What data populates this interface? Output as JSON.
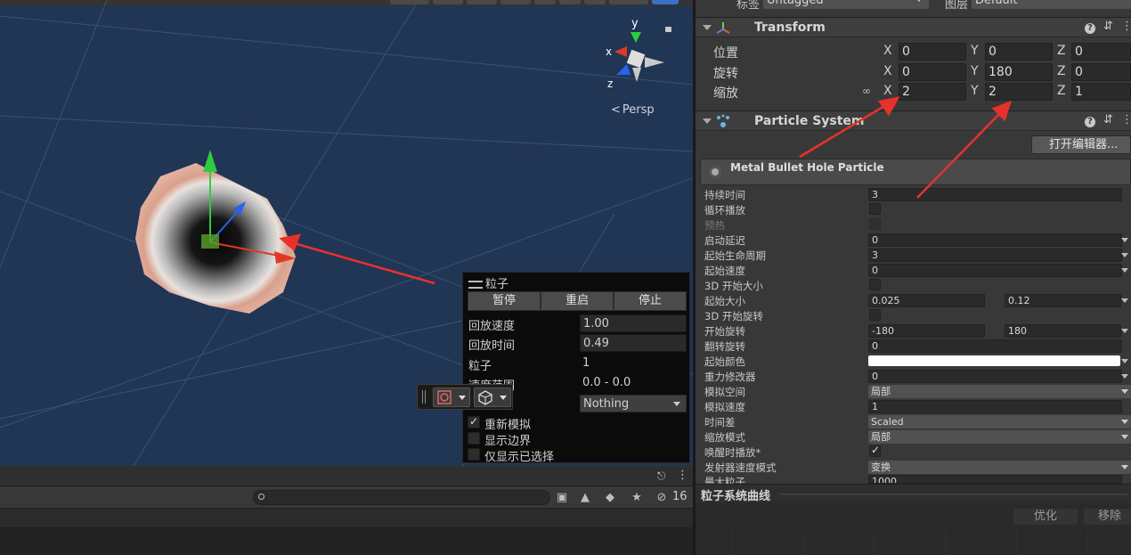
{
  "scene": {
    "persp_label": "Persp",
    "gizmo_axes": {
      "y": "y",
      "x": "x",
      "z": "z"
    }
  },
  "particle_panel": {
    "title": "粒子",
    "buttons": [
      "暂停",
      "重启",
      "停止"
    ],
    "playback_speed_label": "回放速度",
    "playback_speed": "1.00",
    "playback_time_label": "回放时间",
    "playback_time": "0.49",
    "particles_label": "粒子",
    "particles": "1",
    "speed_range_label": "速度范围",
    "speed_range": "0.0 - 0.0",
    "layer_value": "Nothing",
    "resimulate_label": "重新模拟",
    "resimulate_checked": true,
    "show_bounds_label": "显示边界",
    "show_bounds_checked": false,
    "show_selected_label": "仅显示已选择",
    "show_selected_checked": false
  },
  "project_bar": {
    "search_placeholder": "",
    "hidden_count": "16"
  },
  "inspector": {
    "tag_label": "标签",
    "tag_value": "Untagged",
    "layer_label": "图层",
    "layer_value": "Default",
    "transform": {
      "title": "Transform",
      "position_label": "位置",
      "rotation_label": "旋转",
      "scale_label": "缩放",
      "position": {
        "x": "0",
        "y": "0",
        "z": "0"
      },
      "rotation": {
        "x": "0",
        "y": "180",
        "z": "0"
      },
      "scale": {
        "x": "2",
        "y": "2",
        "z": "1"
      },
      "axis_x": "X",
      "axis_y": "Y",
      "axis_z": "Z"
    },
    "particle_system": {
      "title": "Particle System",
      "open_editor": "打开编辑器...",
      "system_name": "Metal Bullet Hole Particle",
      "rows": {
        "duration_label": "持续时间",
        "duration": "3",
        "looping_label": "循环播放",
        "prewarm_label": "预热",
        "start_delay_label": "启动延迟",
        "start_delay": "0",
        "start_lifetime_label": "起始生命周期",
        "start_lifetime": "3",
        "start_speed_label": "起始速度",
        "start_speed": "0",
        "size3d_label": "3D 开始大小",
        "start_size_label": "起始大小",
        "start_size_min": "0.025",
        "start_size_max": "0.12",
        "rot3d_label": "3D 开始旋转",
        "start_rotation_label": "开始旋转",
        "start_rotation_min": "-180",
        "start_rotation_max": "180",
        "flip_rotation_label": "翻转旋转",
        "flip_rotation": "0",
        "start_color_label": "起始颜色",
        "gravity_label": "重力修改器",
        "gravity": "0",
        "sim_space_label": "模拟空间",
        "sim_space": "局部",
        "sim_speed_label": "模拟速度",
        "sim_speed": "1",
        "delta_time_label": "时间差",
        "delta_time": "Scaled",
        "scaling_mode_label": "缩放模式",
        "scaling_mode": "局部",
        "play_on_awake_label": "唤醒时播放*",
        "emitter_velocity_label": "发射器速度模式",
        "emitter_velocity": "变换",
        "max_particles_label": "最大粒子",
        "max_particles": "1000"
      },
      "start_color": "#ffffff"
    },
    "curves": {
      "title": "粒子系统曲线",
      "optimize": "优化",
      "remove": "移除"
    }
  },
  "colors": {
    "scene_bg": "#213554",
    "annotation_red": "#e8312b",
    "gizmo_green": "#2ecc40",
    "gizmo_blue": "#2a62e8",
    "gizmo_red": "#e03a25"
  }
}
